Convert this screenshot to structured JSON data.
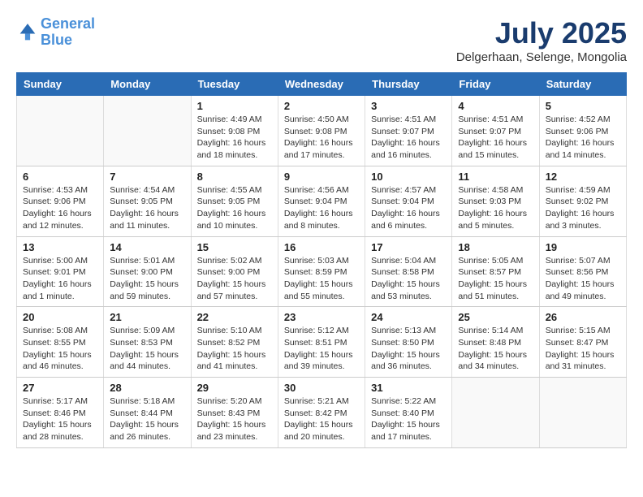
{
  "header": {
    "logo_line1": "General",
    "logo_line2": "Blue",
    "month_year": "July 2025",
    "location": "Delgerhaan, Selenge, Mongolia"
  },
  "weekdays": [
    "Sunday",
    "Monday",
    "Tuesday",
    "Wednesday",
    "Thursday",
    "Friday",
    "Saturday"
  ],
  "weeks": [
    [
      {
        "day": "",
        "info": ""
      },
      {
        "day": "",
        "info": ""
      },
      {
        "day": "1",
        "info": "Sunrise: 4:49 AM\nSunset: 9:08 PM\nDaylight: 16 hours\nand 18 minutes."
      },
      {
        "day": "2",
        "info": "Sunrise: 4:50 AM\nSunset: 9:08 PM\nDaylight: 16 hours\nand 17 minutes."
      },
      {
        "day": "3",
        "info": "Sunrise: 4:51 AM\nSunset: 9:07 PM\nDaylight: 16 hours\nand 16 minutes."
      },
      {
        "day": "4",
        "info": "Sunrise: 4:51 AM\nSunset: 9:07 PM\nDaylight: 16 hours\nand 15 minutes."
      },
      {
        "day": "5",
        "info": "Sunrise: 4:52 AM\nSunset: 9:06 PM\nDaylight: 16 hours\nand 14 minutes."
      }
    ],
    [
      {
        "day": "6",
        "info": "Sunrise: 4:53 AM\nSunset: 9:06 PM\nDaylight: 16 hours\nand 12 minutes."
      },
      {
        "day": "7",
        "info": "Sunrise: 4:54 AM\nSunset: 9:05 PM\nDaylight: 16 hours\nand 11 minutes."
      },
      {
        "day": "8",
        "info": "Sunrise: 4:55 AM\nSunset: 9:05 PM\nDaylight: 16 hours\nand 10 minutes."
      },
      {
        "day": "9",
        "info": "Sunrise: 4:56 AM\nSunset: 9:04 PM\nDaylight: 16 hours\nand 8 minutes."
      },
      {
        "day": "10",
        "info": "Sunrise: 4:57 AM\nSunset: 9:04 PM\nDaylight: 16 hours\nand 6 minutes."
      },
      {
        "day": "11",
        "info": "Sunrise: 4:58 AM\nSunset: 9:03 PM\nDaylight: 16 hours\nand 5 minutes."
      },
      {
        "day": "12",
        "info": "Sunrise: 4:59 AM\nSunset: 9:02 PM\nDaylight: 16 hours\nand 3 minutes."
      }
    ],
    [
      {
        "day": "13",
        "info": "Sunrise: 5:00 AM\nSunset: 9:01 PM\nDaylight: 16 hours\nand 1 minute."
      },
      {
        "day": "14",
        "info": "Sunrise: 5:01 AM\nSunset: 9:00 PM\nDaylight: 15 hours\nand 59 minutes."
      },
      {
        "day": "15",
        "info": "Sunrise: 5:02 AM\nSunset: 9:00 PM\nDaylight: 15 hours\nand 57 minutes."
      },
      {
        "day": "16",
        "info": "Sunrise: 5:03 AM\nSunset: 8:59 PM\nDaylight: 15 hours\nand 55 minutes."
      },
      {
        "day": "17",
        "info": "Sunrise: 5:04 AM\nSunset: 8:58 PM\nDaylight: 15 hours\nand 53 minutes."
      },
      {
        "day": "18",
        "info": "Sunrise: 5:05 AM\nSunset: 8:57 PM\nDaylight: 15 hours\nand 51 minutes."
      },
      {
        "day": "19",
        "info": "Sunrise: 5:07 AM\nSunset: 8:56 PM\nDaylight: 15 hours\nand 49 minutes."
      }
    ],
    [
      {
        "day": "20",
        "info": "Sunrise: 5:08 AM\nSunset: 8:55 PM\nDaylight: 15 hours\nand 46 minutes."
      },
      {
        "day": "21",
        "info": "Sunrise: 5:09 AM\nSunset: 8:53 PM\nDaylight: 15 hours\nand 44 minutes."
      },
      {
        "day": "22",
        "info": "Sunrise: 5:10 AM\nSunset: 8:52 PM\nDaylight: 15 hours\nand 41 minutes."
      },
      {
        "day": "23",
        "info": "Sunrise: 5:12 AM\nSunset: 8:51 PM\nDaylight: 15 hours\nand 39 minutes."
      },
      {
        "day": "24",
        "info": "Sunrise: 5:13 AM\nSunset: 8:50 PM\nDaylight: 15 hours\nand 36 minutes."
      },
      {
        "day": "25",
        "info": "Sunrise: 5:14 AM\nSunset: 8:48 PM\nDaylight: 15 hours\nand 34 minutes."
      },
      {
        "day": "26",
        "info": "Sunrise: 5:15 AM\nSunset: 8:47 PM\nDaylight: 15 hours\nand 31 minutes."
      }
    ],
    [
      {
        "day": "27",
        "info": "Sunrise: 5:17 AM\nSunset: 8:46 PM\nDaylight: 15 hours\nand 28 minutes."
      },
      {
        "day": "28",
        "info": "Sunrise: 5:18 AM\nSunset: 8:44 PM\nDaylight: 15 hours\nand 26 minutes."
      },
      {
        "day": "29",
        "info": "Sunrise: 5:20 AM\nSunset: 8:43 PM\nDaylight: 15 hours\nand 23 minutes."
      },
      {
        "day": "30",
        "info": "Sunrise: 5:21 AM\nSunset: 8:42 PM\nDaylight: 15 hours\nand 20 minutes."
      },
      {
        "day": "31",
        "info": "Sunrise: 5:22 AM\nSunset: 8:40 PM\nDaylight: 15 hours\nand 17 minutes."
      },
      {
        "day": "",
        "info": ""
      },
      {
        "day": "",
        "info": ""
      }
    ]
  ]
}
